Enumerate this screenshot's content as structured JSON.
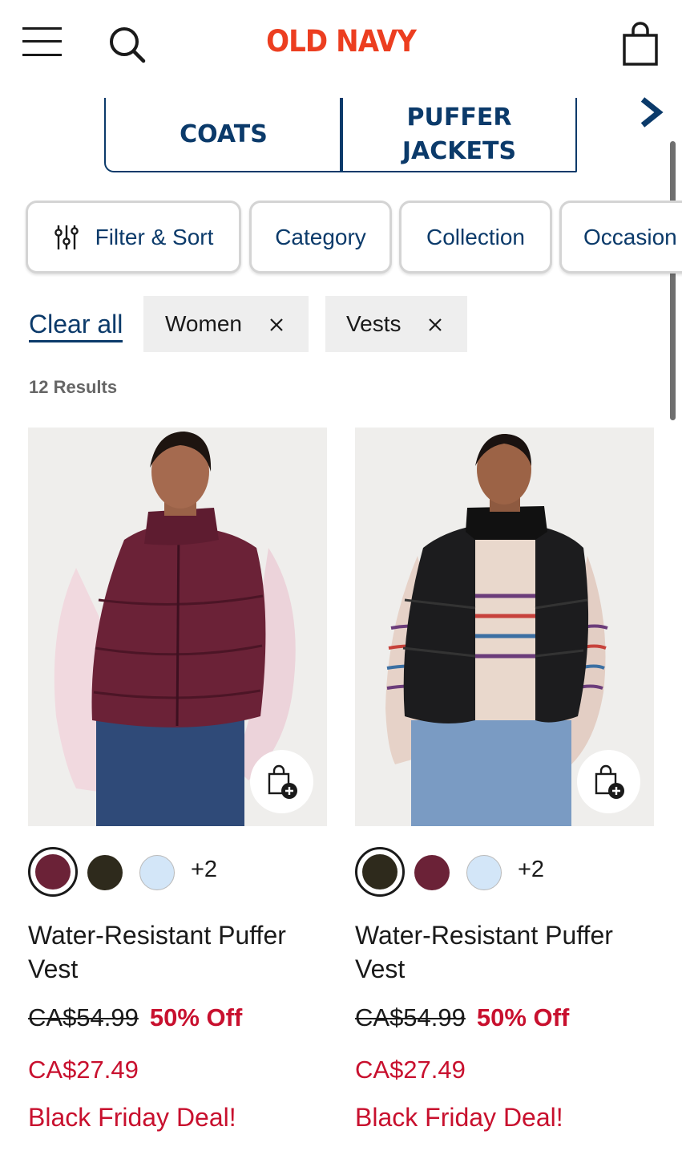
{
  "header": {
    "logo": "OLD NAVY",
    "icons": [
      "menu-icon",
      "search-icon",
      "shopping-bag-icon"
    ]
  },
  "category_tabs": [
    {
      "label": "COATS"
    },
    {
      "label": "PUFFER JACKETS"
    }
  ],
  "filter_chips": [
    {
      "label": "Filter & Sort",
      "icon": "sliders-icon"
    },
    {
      "label": "Category"
    },
    {
      "label": "Collection"
    },
    {
      "label": "Occasion"
    }
  ],
  "applied_filters": {
    "clear_label": "Clear all",
    "pills": [
      {
        "label": "Women"
      },
      {
        "label": "Vests"
      }
    ]
  },
  "results_text": "12 Results",
  "products": [
    {
      "name": "Water-Resistant Puffer Vest",
      "original_price": "CA$54.99",
      "discount": "50% Off",
      "sale_price": "CA$27.49",
      "promo": "Black Friday Deal!",
      "swatches": [
        "#6b2237",
        "#2e2a1c",
        "#d3e6f8"
      ],
      "selected_swatch": 0,
      "more_colors": "+2"
    },
    {
      "name": "Water-Resistant Puffer Vest",
      "original_price": "CA$54.99",
      "discount": "50% Off",
      "sale_price": "CA$27.49",
      "promo": "Black Friday Deal!",
      "swatches": [
        "#2e2a1c",
        "#6b2237",
        "#d3e6f8"
      ],
      "selected_swatch": 0,
      "more_colors": "+2"
    }
  ],
  "colors": {
    "brand": "#ec3e20",
    "navy": "#0b3a6a",
    "sale_red": "#c8102e"
  }
}
